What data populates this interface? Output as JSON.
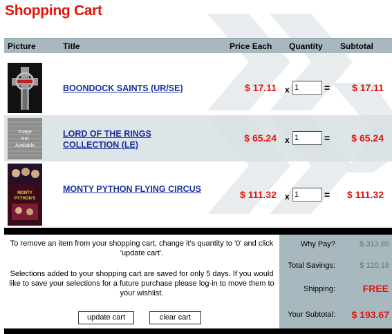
{
  "page": {
    "title": "Shopping Cart"
  },
  "columns": {
    "picture": "Picture",
    "title": "Title",
    "price_each": "Price Each",
    "quantity": "Quantity",
    "subtotal": "Subtotal"
  },
  "items": [
    {
      "title": "BOONDOCK SAINTS (UR/SE)",
      "price": "$ 17.11",
      "qty_prefix": "x",
      "qty": "1",
      "equals": "=",
      "subtotal": "$ 17.11",
      "thumb_caption": ""
    },
    {
      "title": "LORD OF THE RINGS COLLECTION (LE)",
      "price": "$ 65.24",
      "qty_prefix": "x",
      "qty": "1",
      "equals": "=",
      "subtotal": "$ 65.24",
      "thumb_caption": "Image Not Available"
    },
    {
      "title": "MONTY PYTHON FLYING CIRCUS",
      "price": "$ 111.32",
      "qty_prefix": "x",
      "qty": "1",
      "equals": "=",
      "subtotal": "$ 111.32",
      "thumb_caption": "MONTY PYTHON'S"
    }
  ],
  "notes": {
    "remove": "To remove an item from your shopping cart, change it's quantity to '0' and click 'update cart'.",
    "saved": "Selections added to your shopping cart are saved for only 5 days. If you would like to save your selections for a future purchase please log-in to move them to your wishlist."
  },
  "buttons": {
    "update": "update cart",
    "clear": "clear cart"
  },
  "summary": {
    "why_pay_label": "Why Pay?",
    "why_pay_value": "$ 313.85",
    "savings_label": "Total Savings:",
    "savings_value": "$ 120.18",
    "shipping_label": "Shipping:",
    "shipping_value": "FREE",
    "subtotal_label": "Your Subtotal:",
    "subtotal_value": "$ 193.67"
  },
  "colors": {
    "accent_red": "#e0140c",
    "link_blue": "#1a2f9e",
    "header_gray": "#a7b8bf"
  }
}
